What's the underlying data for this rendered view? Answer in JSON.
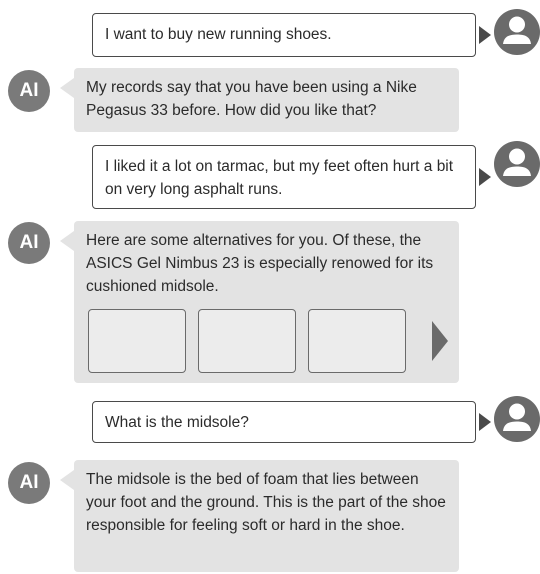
{
  "ai_avatar_label": "AI",
  "messages": [
    {
      "role": "user",
      "text": "I want to buy new running shoes."
    },
    {
      "role": "ai",
      "text": "My records say that you have been using a Nike Pegasus 33 before. How did you like that?"
    },
    {
      "role": "user",
      "text": "I liked it a lot on tarmac, but my feet often hurt a bit on very long asphalt runs."
    },
    {
      "role": "ai",
      "text": "Here are some alternatives for you. Of these, the ASICS Gel Nimbus 23 is especially renowed for its cushioned midsole."
    },
    {
      "role": "user",
      "text": "What is the midsole?"
    },
    {
      "role": "ai",
      "text": "The midsole is the bed of foam that lies between your foot and the ground. This is the part of the shoe responsible for feeling soft or hard in the shoe."
    }
  ],
  "product_carousel": {
    "card_count": 3,
    "has_next_arrow": true
  },
  "icons": {
    "user_avatar": "user-person-icon",
    "carousel_next": "chevron-right-icon"
  },
  "colors": {
    "ai_bubble": "#e3e3e3",
    "ai_avatar": "#7a7a7a",
    "user_icon": "#6a6a6a",
    "user_border": "#4a4a4a"
  }
}
